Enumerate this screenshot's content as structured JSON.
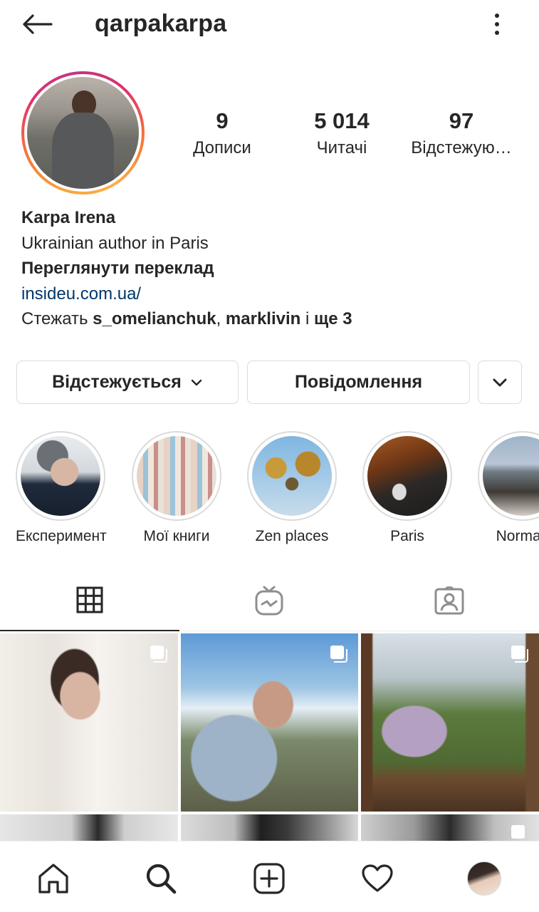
{
  "header": {
    "username": "qarpakarpa"
  },
  "stats": [
    {
      "value": "9",
      "label": "Дописи"
    },
    {
      "value": "5 014",
      "label": "Читачі"
    },
    {
      "value": "97",
      "label": "Відстежую…"
    }
  ],
  "bio": {
    "name": "Karpa Irena",
    "description": "Ukrainian author in Paris",
    "translation": "Переглянути переклад",
    "website": "insideu.com.ua/",
    "followed_prefix": "Стежать ",
    "followed_user1": "s_omelianchuk",
    "followed_sep": ", ",
    "followed_user2": "marklivin",
    "followed_and": " і ",
    "followed_more": "ще 3"
  },
  "actions": {
    "following": "Відстежується",
    "message": "Повідомлення"
  },
  "highlights": [
    {
      "label": "Експеримент"
    },
    {
      "label": "Мої книги"
    },
    {
      "label": "Zen places"
    },
    {
      "label": "Paris"
    },
    {
      "label": "Norman"
    }
  ],
  "tabs": [
    {
      "icon": "grid-icon"
    },
    {
      "icon": "igtv-icon"
    },
    {
      "icon": "tagged-icon"
    }
  ],
  "colors": {
    "text": "#262626",
    "link": "#00376b",
    "border": "#dbdbdb",
    "ring_start": "#fcaf45",
    "ring_end": "#c13584"
  },
  "bottom_nav": [
    {
      "icon": "home-icon"
    },
    {
      "icon": "search-icon"
    },
    {
      "icon": "new-post-icon"
    },
    {
      "icon": "activity-heart-icon"
    },
    {
      "icon": "profile-avatar-icon"
    }
  ]
}
